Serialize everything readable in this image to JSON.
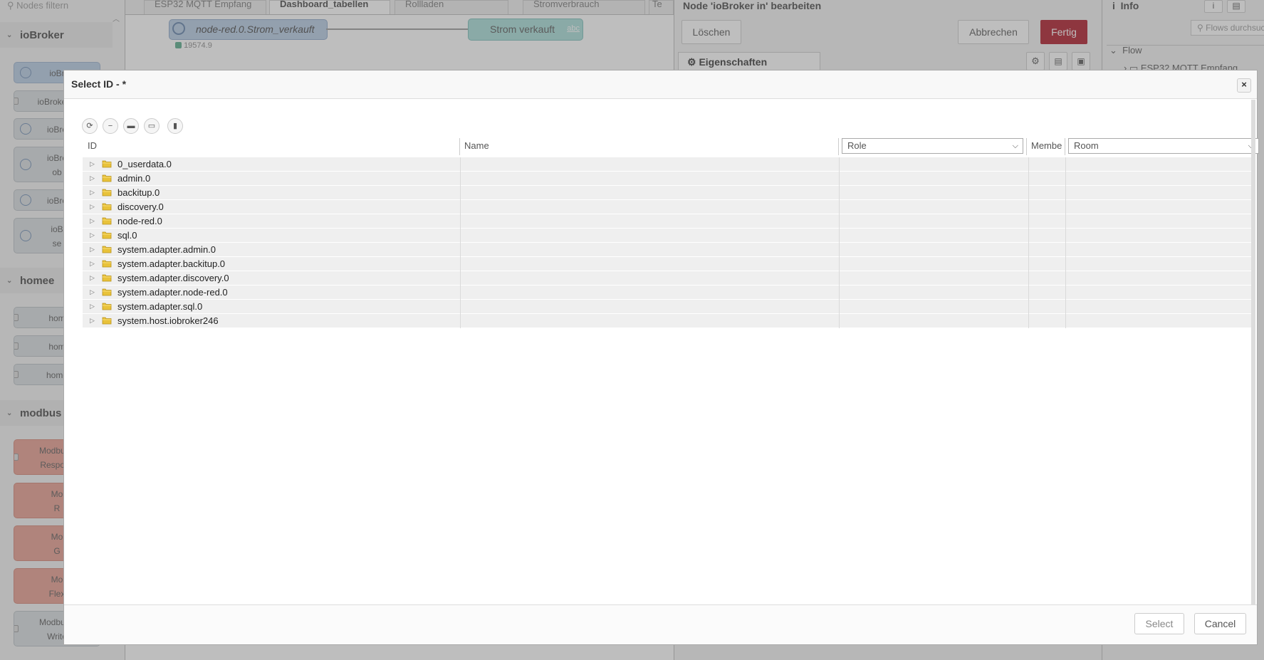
{
  "palette": {
    "filter_placeholder": "Nodes filtern",
    "categories": [
      {
        "label": "ioBroker",
        "nodes": [
          {
            "label": "ioBr"
          },
          {
            "label": "ioBroker o"
          },
          {
            "label": "ioBro"
          },
          {
            "label": "ioBro\nob"
          },
          {
            "label": "ioBro"
          },
          {
            "label": "ioB\nse"
          }
        ]
      },
      {
        "label": "homee",
        "nodes": [
          {
            "label": "hom"
          },
          {
            "label": "hom"
          },
          {
            "label": "home"
          }
        ]
      },
      {
        "label": "modbus",
        "nodes": [
          {
            "label": "Modbus -\nRespons"
          },
          {
            "label": "Mo\nR"
          },
          {
            "label": "Mo\nG"
          },
          {
            "label": "Mo\nFlex"
          },
          {
            "label": "Modbus -\nWrite"
          }
        ]
      }
    ]
  },
  "workspace": {
    "tabs": [
      "ESP32 MQTT Empfang",
      "Dashboard_tabellen",
      "Rollladen",
      "Stromverbrauch",
      "Te"
    ],
    "active_tab": "Dashboard_tabellen",
    "nodes": {
      "input_label": "node-red.0.Strom_verkauft",
      "input_status": "19574.9",
      "output_label": "Strom verkauft",
      "output_badge": "abc"
    }
  },
  "tray": {
    "title": "Node 'ioBroker in' bearbeiten",
    "delete_label": "Löschen",
    "cancel_label": "Abbrechen",
    "done_label": "Fertig",
    "properties_tab": "Eigenschaften"
  },
  "sidebar": {
    "title": "Info",
    "search_placeholder": "Flows durchsuc",
    "flow_label": "Flow",
    "flow_item": "ESP32 MQTT Empfang"
  },
  "dialog": {
    "title": "Select ID - *",
    "columns": {
      "id": "ID",
      "name": "Name",
      "role": "Role",
      "members": "Membe",
      "room": "Room"
    },
    "rows": [
      "0_userdata.0",
      "admin.0",
      "backitup.0",
      "discovery.0",
      "node-red.0",
      "sql.0",
      "system.adapter.admin.0",
      "system.adapter.backitup.0",
      "system.adapter.discovery.0",
      "system.adapter.node-red.0",
      "system.adapter.sql.0",
      "system.host.iobroker246"
    ],
    "select_label": "Select",
    "cancel_label": "Cancel"
  },
  "colors": {
    "accent_red": "#ad1625",
    "folder_yellow": "#e8c23a"
  }
}
